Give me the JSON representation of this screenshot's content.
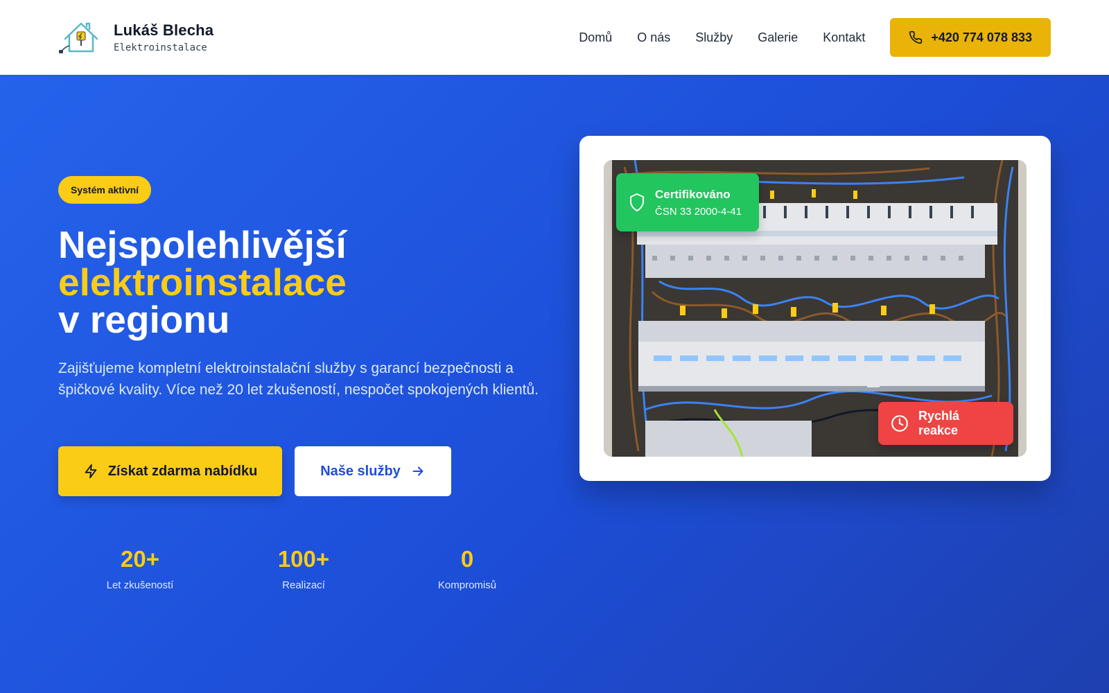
{
  "brand": {
    "name": "Lukáš Blecha",
    "subtitle": "Elektroinstalace",
    "logo_icon": "house-plug-icon"
  },
  "nav": {
    "items": [
      {
        "label": "Domů"
      },
      {
        "label": "O nás"
      },
      {
        "label": "Služby"
      },
      {
        "label": "Galerie"
      },
      {
        "label": "Kontakt"
      }
    ],
    "phone_label": "+420 774 078 833",
    "phone_icon": "phone-icon"
  },
  "hero": {
    "badge": "Systém aktivní",
    "title_line1": "Nejspolehlivější",
    "title_line2": "elektroinstalace",
    "title_line3": "v regionu",
    "lead": "Zajišťujeme kompletní elektroinstalační služby s garancí bezpečnosti a špičkové kvality. Více než 20 let zkušeností, nespočet spokojených klientů.",
    "cta_primary": "Získat zdarma nabídku",
    "cta_secondary": "Naše služby",
    "stats": [
      {
        "value": "20+",
        "label": "Let zkušeností"
      },
      {
        "value": "100+",
        "label": "Realizací"
      },
      {
        "value": "0",
        "label": "Kompromisů"
      }
    ]
  },
  "card": {
    "cert_title": "Certifikováno",
    "cert_sub": "ČSN 33 2000-4-41",
    "quick_label": "Rychlá reakce"
  },
  "colors": {
    "accent_yellow": "#facc15",
    "hero_blue": "#1d4ed8",
    "cert_green": "#22c55e",
    "quick_red": "#ef4444"
  }
}
